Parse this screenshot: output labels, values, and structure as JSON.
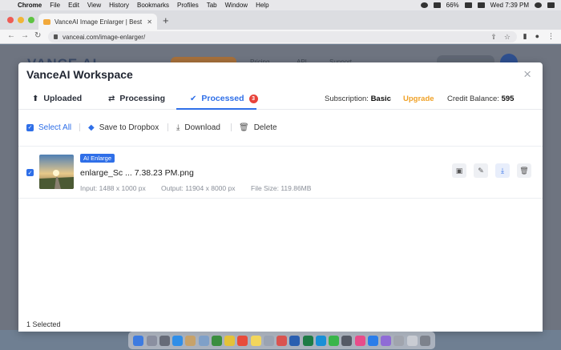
{
  "menubar": {
    "app": "Chrome",
    "items": [
      "File",
      "Edit",
      "View",
      "History",
      "Bookmarks",
      "Profiles",
      "Tab",
      "Window",
      "Help"
    ],
    "battery": "66%",
    "clock": "Wed 7:39 PM"
  },
  "browser": {
    "tab_title": "VanceAI Image Enlarger | Best",
    "url": "vanceai.com/image-enlarger/"
  },
  "background_page": {
    "logo": "VANCE AI",
    "nav": [
      "Pricing",
      "API",
      "Support"
    ]
  },
  "modal": {
    "title": "VanceAI Workspace",
    "close": "×",
    "tabs": [
      {
        "label": "Uploaded",
        "glyph": "⬆"
      },
      {
        "label": "Processing",
        "glyph": "⇄"
      },
      {
        "label": "Processed",
        "glyph": "✔",
        "badge": "3"
      }
    ],
    "subscription_label": "Subscription:",
    "subscription_value": "Basic",
    "upgrade": "Upgrade",
    "credit_label": "Credit Balance:",
    "credit_value": "595",
    "toolbar": {
      "select_all": "Select All",
      "dropbox": "Save to Dropbox",
      "download": "Download",
      "delete": "Delete"
    },
    "file": {
      "tag": "AI Enlarge",
      "name": "enlarge_Sc ... 7.38.23 PM.png",
      "input": "Input: 1488 x 1000 px",
      "output": "Output: 11904 x 8000 px",
      "size": "File Size: 119.86MB"
    },
    "footer": "1  Selected"
  },
  "colors": {
    "accent": "#2f6fe8",
    "upgrade": "#f0a126",
    "badge": "#e8433a"
  }
}
